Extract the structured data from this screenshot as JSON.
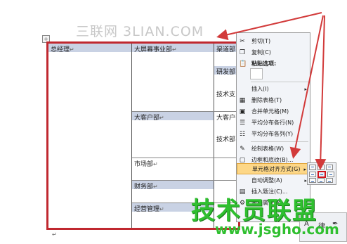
{
  "watermark_top": "三联网 3LIAN.COM",
  "table": {
    "col1_header": "总经理",
    "col2_rows": [
      "大屏幕事业部",
      "大客户部",
      "市场部",
      "财务部",
      "经营管理"
    ],
    "col3_rows": [
      "渠道部",
      "研发部",
      "技术支",
      "大客户部",
      "技术部"
    ],
    "cell_mark": "↵"
  },
  "context_menu": {
    "items": [
      {
        "icon": "scissors-icon",
        "glyph": "✂",
        "label": "剪切(T)"
      },
      {
        "icon": "copy-icon",
        "glyph": "❐",
        "label": "复制(C)"
      },
      {
        "icon": "paste-icon",
        "glyph": "📋",
        "label": "粘贴选项:"
      },
      {
        "icon": "none",
        "glyph": "",
        "label": "插入(I)",
        "arrow": "▸"
      },
      {
        "icon": "delete-table-icon",
        "glyph": "▦",
        "label": "删除表格(T)"
      },
      {
        "icon": "merge-cells-icon",
        "glyph": "▣",
        "label": "合并单元格(M)"
      },
      {
        "icon": "distribute-rows-icon",
        "glyph": "☰",
        "label": "平均分布各行(N)"
      },
      {
        "icon": "distribute-cols-icon",
        "glyph": "☷",
        "label": "平均分布各列(Y)"
      },
      {
        "icon": "draw-table-icon",
        "glyph": "✎",
        "label": "绘制表格(W)"
      },
      {
        "icon": "borders-icon",
        "glyph": "▢",
        "label": "边框和底纹(B)..."
      },
      {
        "icon": "none",
        "glyph": "",
        "label": "单元格对齐方式(G)",
        "arrow": "▸"
      },
      {
        "icon": "none",
        "glyph": "",
        "label": "自动调整(A)",
        "arrow": "▸"
      },
      {
        "icon": "caption-icon",
        "glyph": "▤",
        "label": "插入题注(C)..."
      },
      {
        "icon": "properties-icon",
        "glyph": "⚙",
        "label": "表格属性(R)..."
      }
    ]
  },
  "brand_watermark": {
    "title": "技术员联盟",
    "url": "www.jsgho.com"
  },
  "mini_toolbar": {
    "glyph_a": "A",
    "glyph_b": "律",
    "glyph_c": "✒"
  },
  "colors": {
    "table_border": "#c0282f",
    "cell_highlight": "#c9d2e4",
    "menu_selected": "#fdd787",
    "arrow": "#d23a3a",
    "brand_green": "#2fbf2f"
  }
}
